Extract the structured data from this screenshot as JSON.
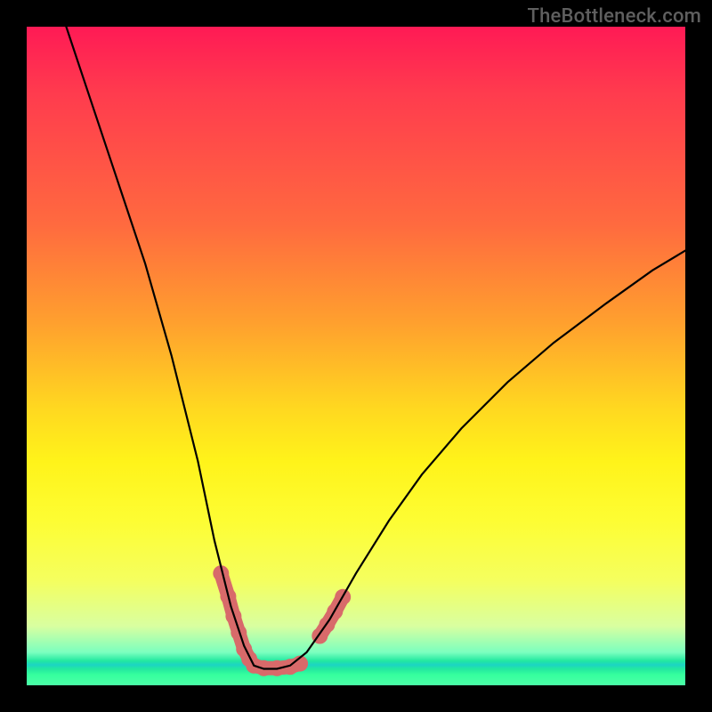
{
  "watermark": "TheBottleneck.com",
  "chart_data": {
    "type": "line",
    "title": "",
    "xlabel": "",
    "ylabel": "",
    "xlim": [
      0,
      100
    ],
    "ylim": [
      0,
      100
    ],
    "grid": false,
    "legend": null,
    "series": [
      {
        "name": "bottleneck-curve",
        "x": [
          6,
          10,
          14,
          18,
          22,
          26,
          28.5,
          31,
          33,
          34.5,
          36,
          38,
          40,
          42.5,
          46,
          50,
          55,
          60,
          66,
          73,
          80,
          88,
          95,
          100
        ],
        "y": [
          100,
          88,
          76,
          64,
          50,
          34,
          22,
          12,
          6,
          3,
          2.5,
          2.5,
          3,
          5,
          10,
          17,
          25,
          32,
          39,
          46,
          52,
          58,
          63,
          66
        ]
      }
    ],
    "accent_segments": [
      {
        "name": "left-descent-marker",
        "points": [
          [
            29.5,
            17
          ],
          [
            30.6,
            13.5
          ],
          [
            31.4,
            10.5
          ],
          [
            32.2,
            8
          ],
          [
            33.0,
            5.5
          ],
          [
            33.8,
            4
          ]
        ]
      },
      {
        "name": "valley-floor-marker",
        "points": [
          [
            34.5,
            3
          ],
          [
            36,
            2.6
          ],
          [
            38,
            2.6
          ],
          [
            40,
            2.8
          ],
          [
            41.5,
            3.3
          ]
        ]
      },
      {
        "name": "right-ascent-marker",
        "points": [
          [
            44.5,
            7.5
          ],
          [
            45.6,
            9.2
          ],
          [
            46.8,
            11.2
          ],
          [
            48.0,
            13.4
          ]
        ]
      }
    ],
    "colors": {
      "curve": "#000000",
      "accent": "#d86a6a",
      "gradient_top": "#ff1a55",
      "gradient_bottom": "#4bffa7"
    }
  }
}
